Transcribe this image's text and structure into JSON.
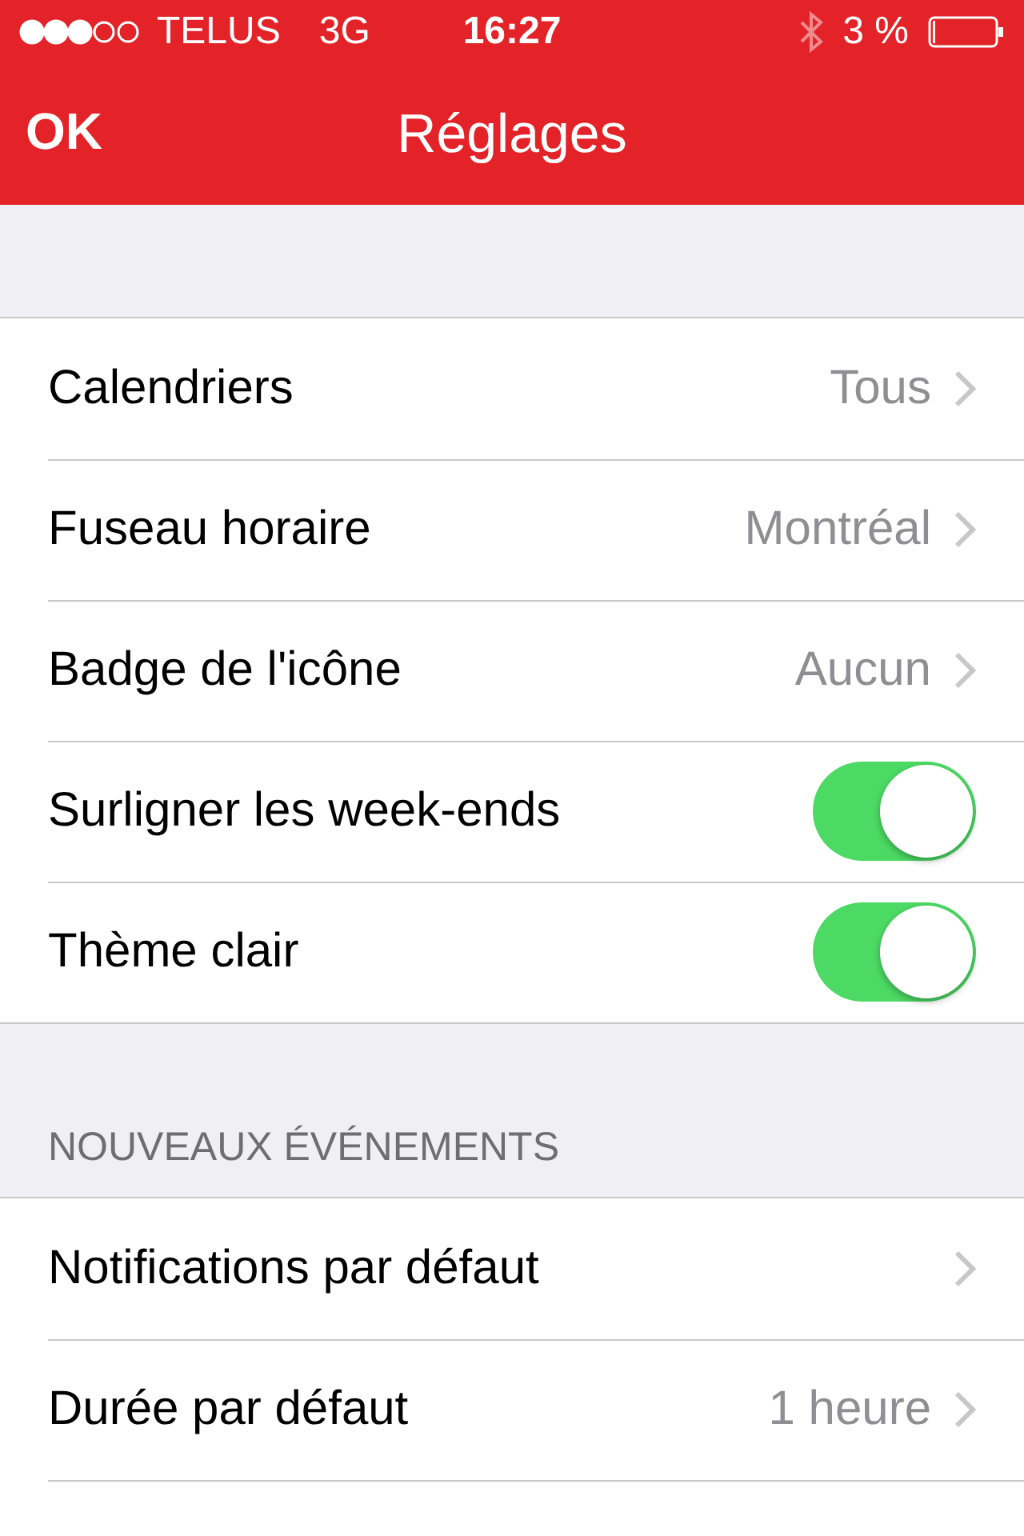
{
  "status_bar": {
    "carrier": "TELUS",
    "network": "3G",
    "time": "16:27",
    "battery": "3 %"
  },
  "nav_bar": {
    "left_button": "OK",
    "title": "Réglages"
  },
  "sections": [
    {
      "items": [
        {
          "kind": "disclosure",
          "label": "Calendriers",
          "value": "Tous"
        },
        {
          "kind": "disclosure",
          "label": "Fuseau horaire",
          "value": "Montréal"
        },
        {
          "kind": "disclosure",
          "label": "Badge de l'icône",
          "value": "Aucun"
        },
        {
          "kind": "toggle",
          "label": "Surligner les week-ends",
          "on": true
        },
        {
          "kind": "toggle",
          "label": "Thème clair",
          "on": true
        }
      ]
    },
    {
      "header": "NOUVEAUX ÉVÉNEMENTS",
      "items": [
        {
          "kind": "disclosure",
          "label": "Notifications par défaut"
        },
        {
          "kind": "disclosure",
          "label": "Durée par défaut",
          "value": "1 heure"
        }
      ]
    }
  ]
}
